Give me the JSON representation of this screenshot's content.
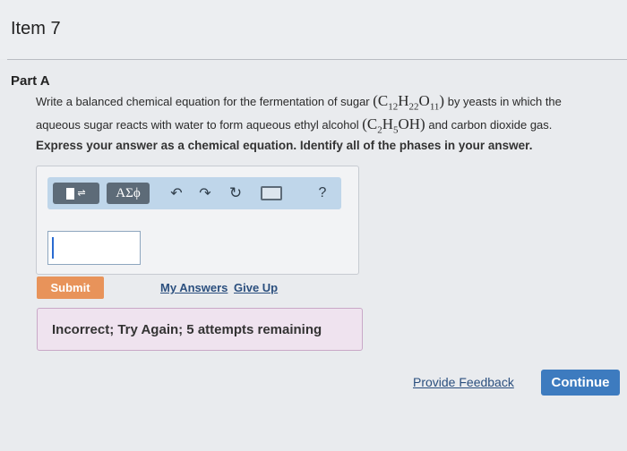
{
  "item": {
    "title": "Item 7"
  },
  "part": {
    "label": "Part A",
    "question": {
      "line1_pre": "Write a balanced chemical equation for the fermentation of sugar",
      "line1_post": "by yeasts in which the",
      "line2_pre": "aqueous sugar reacts with water to form aqueous ethyl alcohol",
      "line2_post": "and carbon dioxide gas.",
      "sugar_formula": "(C12H22O11)",
      "alcohol_formula": "(C2H5OH)"
    },
    "instruction": "Express your answer as a chemical equation. Identify all of the phases in your answer."
  },
  "toolbar": {
    "templates_icon": "templates-icon",
    "greek_label": "ΑΣϕ",
    "undo_icon": "undo-icon",
    "redo_icon": "redo-icon",
    "reset_icon": "reset-icon",
    "keyboard_icon": "keyboard-icon",
    "help_label": "?"
  },
  "answer_input": {
    "value": ""
  },
  "actions": {
    "submit_label": "Submit",
    "my_answers_label": "My Answers",
    "give_up_label": "Give Up"
  },
  "feedback": {
    "message": "Incorrect; Try Again; 5 attempts remaining"
  },
  "footer": {
    "provide_feedback_label": "Provide Feedback",
    "continue_label": "Continue"
  },
  "colors": {
    "submit": "#e8935a",
    "continue": "#3d7bbf",
    "toolbar": "#bfd6ea",
    "feedback_bg": "#efe3ef"
  }
}
